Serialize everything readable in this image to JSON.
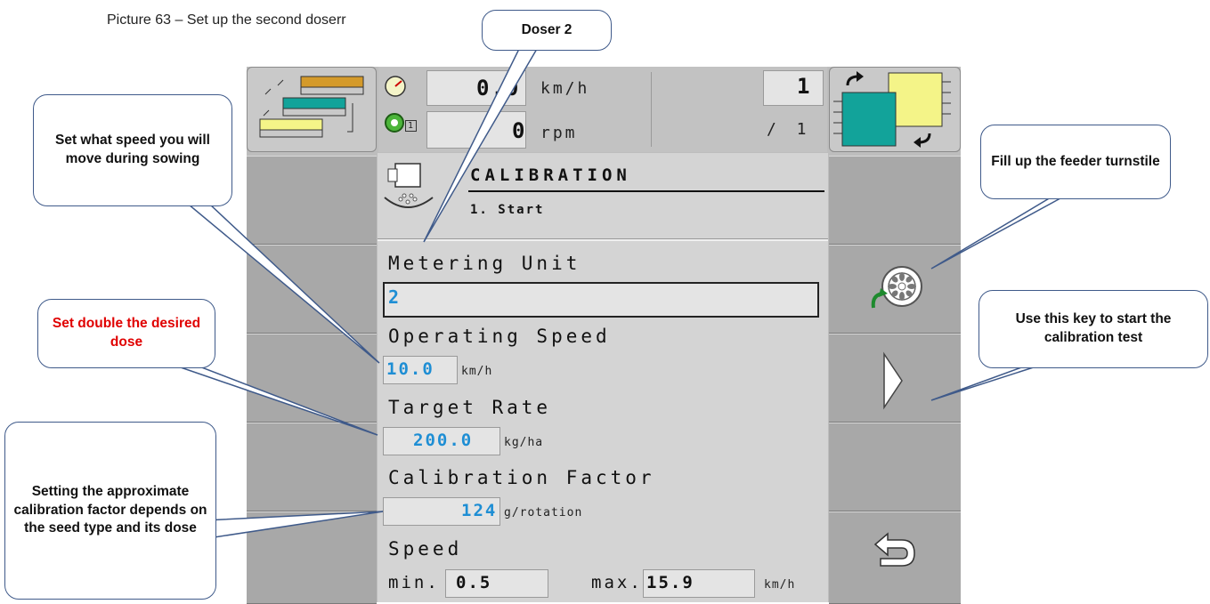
{
  "caption": "Picture 63 – Set up the second doserr",
  "header": {
    "speed_value": "0.0",
    "speed_unit": "km/h",
    "rpm_value": "0",
    "rpm_unit": "rpm",
    "index_top": "1",
    "index_bottom": "/ 1",
    "sensor_index": "1"
  },
  "screen": {
    "title": "CALIBRATION",
    "step": "1. Start",
    "metering_unit_label": "Metering Unit",
    "metering_unit_value": "2",
    "operating_speed_label": "Operating Speed",
    "operating_speed_value": "10.0",
    "operating_speed_unit": "km/h",
    "target_rate_label": "Target Rate",
    "target_rate_value": "200.0",
    "target_rate_unit": "kg/ha",
    "calibration_factor_label": "Calibration Factor",
    "calibration_factor_value": "124",
    "calibration_factor_unit": "g/rotation",
    "speed_label": "Speed",
    "min_label": "min.",
    "min_value": "0.5",
    "max_label": "max.",
    "max_value": "15.9",
    "speed_unit": "km/h"
  },
  "callouts": {
    "doser": "Doser 2",
    "speed": "Set what speed you will move during sowing",
    "dose": "Set double the desired dose",
    "factor": "Setting the approximate calibration factor depends on the seed type and its dose",
    "feeder": "Fill up the feeder turnstile",
    "start": "Use this key to start the calibration test"
  },
  "colors": {
    "accent_value": "#1e8ed4",
    "callout_border": "#3f5a8a",
    "warning_text": "#e00000",
    "teal": "#12a39a",
    "yellow": "#f4f488"
  }
}
